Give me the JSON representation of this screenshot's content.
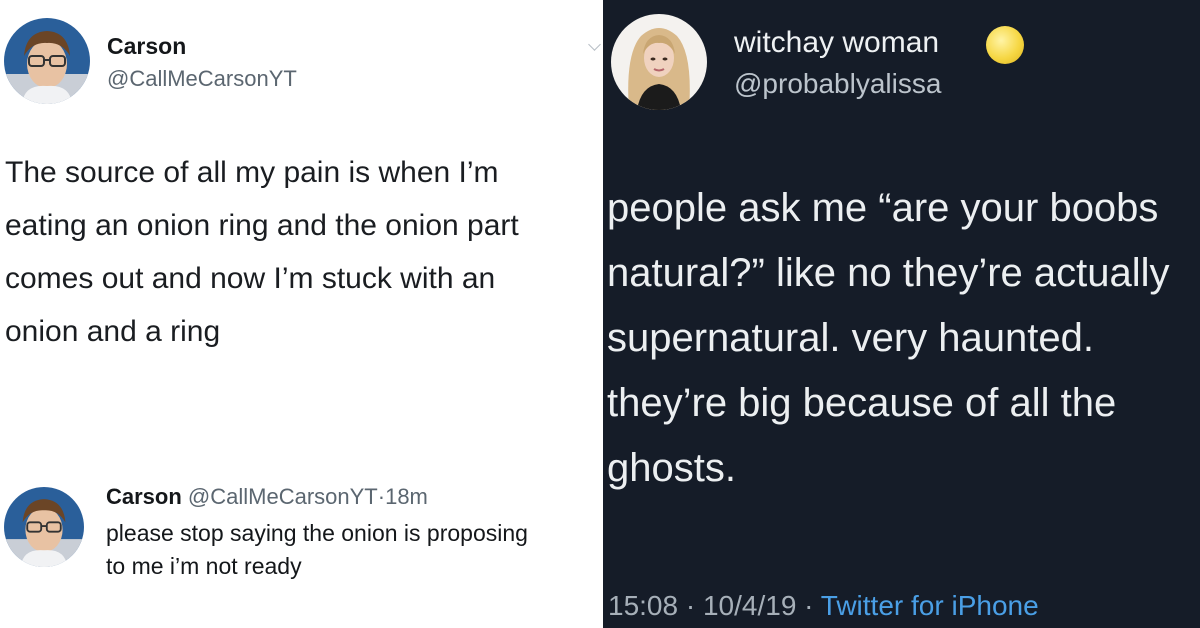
{
  "left_panel": {
    "tweet": {
      "author_name": "Carson",
      "author_handle": "@CallMeCarsonYT",
      "text": "The source of all my pain is when I’m\neating an onion ring and the onion part\ncomes out and now I’m stuck with an\nonion and a ring"
    },
    "reply": {
      "author_name": "Carson",
      "author_handle": "@CallMeCarsonYT",
      "separator": "·",
      "time": "18m",
      "text": "please stop saying the onion is proposing\nto me i’m not ready"
    }
  },
  "right_panel": {
    "tweet": {
      "author_name": "witchay woman",
      "author_emoji_icon": "full-moon-icon",
      "author_handle": "@probablyalissa",
      "text": "people ask me “are your boobs\nnatural?” like no they’re actually\nsupernatural. very haunted.\nthey’re big because of all the\nghosts.",
      "time": "15:08",
      "separator": "·",
      "date": "10/4/19",
      "separator2": "·",
      "source": "Twitter for iPhone"
    }
  },
  "colors": {
    "left_background": "#ffffff",
    "right_background": "#151c28",
    "link_blue": "#4a9fe6"
  }
}
